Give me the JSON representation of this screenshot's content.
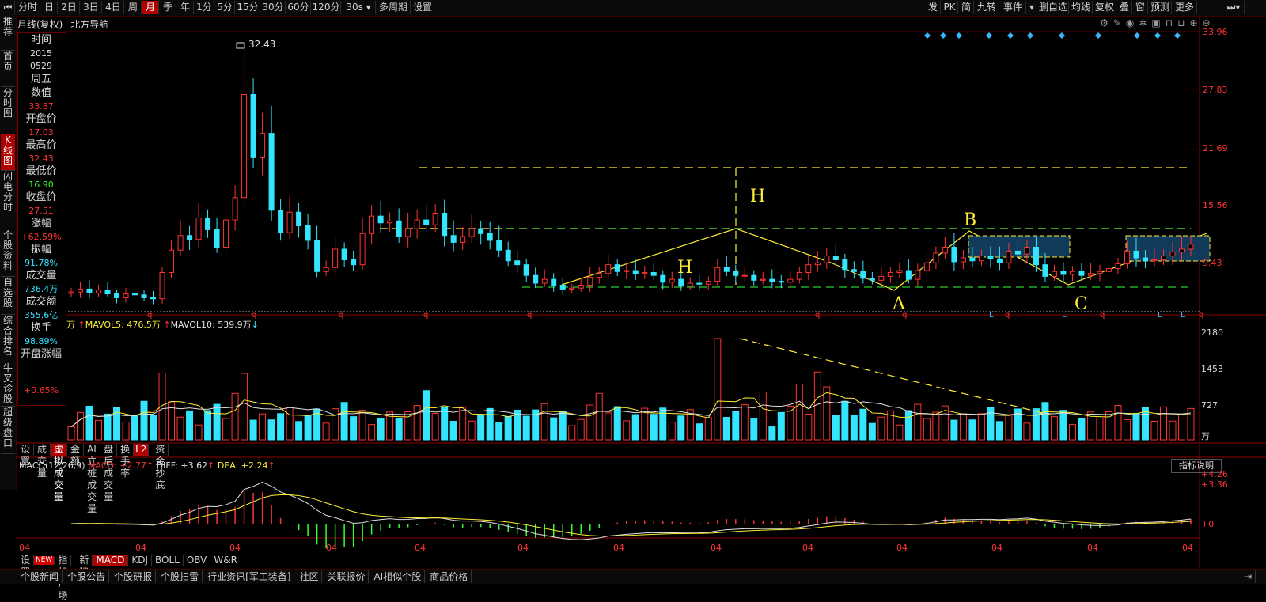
{
  "toolbar": {
    "left": [
      "分时",
      "日",
      "2日",
      "3日",
      "4日",
      "周",
      "月",
      "季",
      "年",
      "1分",
      "5分",
      "15分",
      "30分",
      "60分",
      "120分",
      "30s ▾",
      "多周期",
      "设置"
    ],
    "active_index": 6,
    "right": [
      "发",
      "PK",
      "简",
      "九转",
      "事件",
      "▾",
      "删自选",
      "均线",
      "复权",
      "叠",
      "窗",
      "预测",
      "更多"
    ]
  },
  "chart_header": {
    "period": "月线(复权)",
    "stock": "北方导航"
  },
  "left_nav": [
    "推荐",
    "首页",
    "分时图",
    "K线图",
    "闪电分时",
    "个股资料",
    "自选股",
    "综合排名",
    "牛叉诊股",
    "超级盘口"
  ],
  "left_nav_active": 3,
  "info_panel": {
    "time_label": "时间",
    "date1": "2015",
    "date2": "0529",
    "weekday": "周五",
    "value_label": "数值",
    "value": "33.87",
    "open_label": "开盘价",
    "open": "17.03",
    "high_label": "最高价",
    "high": "32.43",
    "low_label": "最低价",
    "low": "16.90",
    "close_label": "收盘价",
    "close": "27.51",
    "chg_label": "涨幅",
    "chg": "+62.59%",
    "amp_label": "振幅",
    "amp": "91.78%",
    "vol_label": "成交量",
    "vol": "736.4万",
    "amt_label": "成交额",
    "amt": "355.6亿",
    "turn_label": "换手",
    "turn": "98.89%",
    "openchg_label": "开盘涨幅",
    "openchg": "+0.65%"
  },
  "price_axis": [
    "33.96",
    "27.83",
    "21.69",
    "15.56",
    "9.43"
  ],
  "peak_label": "32.43",
  "pattern_labels": {
    "h1": "H",
    "h2": "H",
    "a": "A",
    "b": "B",
    "c": "C"
  },
  "volume_header": {
    "unit": "万",
    "mavol5": "MAVOL5: 476.5万",
    "mavol10": "MAVOL10: 539.9万"
  },
  "volume_axis": [
    "2180",
    "1453",
    "727",
    "万"
  ],
  "indicator_tabs": [
    "设置",
    "成交量",
    "虚拟成交量",
    "金额",
    "AI立桩成交量",
    "盘后成交量",
    "换手率",
    "L2",
    "资金抄底"
  ],
  "indicator_tab_active": 2,
  "macd_header": {
    "name": "MACD(12,26,9)",
    "macd": "MACD: +2.77",
    "diff": "DIFF: +3.62",
    "dea": "DEA: +2.24"
  },
  "macd_button": "指标说明",
  "macd_axis": [
    "+4.26",
    "+3.36",
    "+0"
  ],
  "x_labels": [
    "04",
    "04",
    "04",
    "04",
    "04",
    "04",
    "04",
    "04",
    "04",
    "04",
    "04",
    "04",
    "04"
  ],
  "bottom_tabs": [
    "设置",
    "NEW",
    "指标广场",
    "新建",
    "MACD",
    "KDJ",
    "BOLL",
    "OBV",
    "W&R"
  ],
  "bottom_tab_active": 4,
  "news_tabs": [
    "个股新闻",
    "个股公告",
    "个股研报",
    "个股扫雷",
    "行业资讯[军工装备]",
    "社区",
    "关联报价",
    "AI相似个股",
    "商品价格"
  ],
  "colors": {
    "up": "#ff3333",
    "down": "#33e5ff",
    "accent": "#b00000",
    "pattern": "#ffee33"
  },
  "chart_data": {
    "type": "candlestick",
    "prices": [
      7.2,
      7.5,
      7.1,
      7.4,
      7.0,
      6.6,
      7.0,
      6.9,
      6.6,
      6.5,
      9.2,
      11.5,
      13.0,
      12.6,
      14.8,
      13.6,
      11.8,
      14.6,
      16.9,
      27.5,
      21.0,
      23.5,
      15.6,
      13.3,
      15.4,
      14.0,
      12.5,
      9.3,
      9.7,
      11.6,
      10.5,
      10.0,
      13.2,
      15.0,
      14.3,
      14.5,
      12.9,
      13.7,
      14.6,
      14.1,
      15.3,
      13.0,
      12.3,
      12.9,
      13.7,
      13.2,
      12.5,
      11.5,
      10.4,
      10.0,
      8.9,
      8.1,
      8.5,
      7.9,
      7.5,
      7.6,
      7.9,
      8.7,
      9.1,
      10.0,
      9.3,
      9.4,
      9.1,
      9.2,
      8.9,
      8.2,
      8.5,
      7.8,
      8.1,
      8.0,
      8.3,
      9.7,
      9.3,
      8.9,
      8.9,
      8.4,
      8.5,
      8.3,
      8.2,
      8.5,
      9.2,
      10.0,
      10.2,
      10.9,
      10.5,
      9.5,
      9.3,
      8.6,
      8.4,
      8.8,
      9.2,
      9.4,
      8.5,
      9.4,
      10.2,
      11.2,
      11.8,
      10.3,
      10.7,
      10.4,
      10.9,
      10.6,
      10.2,
      11.4,
      11.1,
      11.8,
      10.0,
      8.8,
      9.3,
      9.0,
      9.3,
      8.9,
      9.1,
      9.3,
      9.6,
      10.1,
      11.4,
      10.7,
      10.4,
      10.5,
      10.9,
      11.3,
      11.6,
      12.1
    ]
  }
}
